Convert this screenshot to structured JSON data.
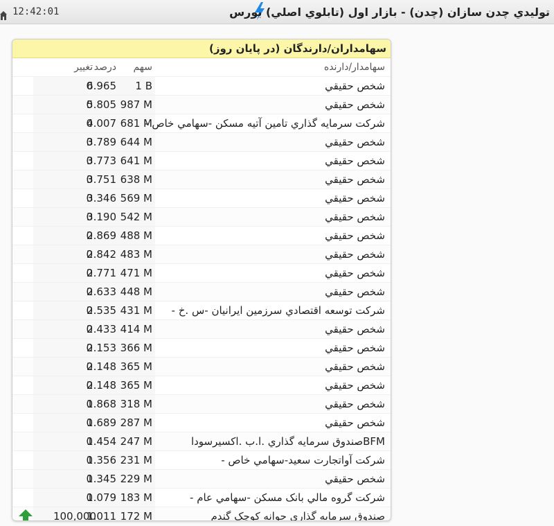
{
  "titlebar": {
    "time": "12:42:01",
    "title": "توليدي چدن سازان (چدن) - بازار اول (تابلوي اصلي) بورس",
    "icons": {
      "left": "home-icon",
      "middle": "lightning-bolt-icon"
    },
    "bolt_color": "#1e88e5"
  },
  "panel": {
    "header": "سهامداران/دارندگان (در پايان روز)",
    "header_bg": "#fbf6a8",
    "columns": {
      "holder": "سهامدار/دارنده",
      "shares": "سهم",
      "percent": "درصد",
      "change": "تغيير"
    },
    "rows": [
      {
        "holder": "شخص حقيقي",
        "shares": "1 B",
        "percent": "6.965",
        "change": "0"
      },
      {
        "holder": "شخص حقيقي",
        "shares": "987 M",
        "percent": "5.805",
        "change": "0"
      },
      {
        "holder": "شرکت سرمايه گذاري تامين آتيه مسکن -سهامي خاص -",
        "shares": "681 M",
        "percent": "4.007",
        "change": "0"
      },
      {
        "holder": "شخص حقيقي",
        "shares": "644 M",
        "percent": "3.789",
        "change": "0"
      },
      {
        "holder": "شخص حقيقي",
        "shares": "641 M",
        "percent": "3.773",
        "change": "0"
      },
      {
        "holder": "شخص حقيقي",
        "shares": "638 M",
        "percent": "3.751",
        "change": "0"
      },
      {
        "holder": "شخص حقيقي",
        "shares": "569 M",
        "percent": "3.346",
        "change": "0"
      },
      {
        "holder": "شخص حقيقي",
        "shares": "542 M",
        "percent": "3.190",
        "change": "0"
      },
      {
        "holder": "شخص حقيقي",
        "shares": "488 M",
        "percent": "2.869",
        "change": "0"
      },
      {
        "holder": "شخص حقيقي",
        "shares": "483 M",
        "percent": "2.842",
        "change": "0"
      },
      {
        "holder": "شخص حقيقي",
        "shares": "471 M",
        "percent": "2.771",
        "change": "0"
      },
      {
        "holder": "شخص حقيقي",
        "shares": "448 M",
        "percent": "2.633",
        "change": "0"
      },
      {
        "holder": "شرکت توسعه اقتصادي سرزمين ايرانيان -س .خ -",
        "shares": "431 M",
        "percent": "2.535",
        "change": "0"
      },
      {
        "holder": "شخص حقيقي",
        "shares": "414 M",
        "percent": "2.433",
        "change": "0"
      },
      {
        "holder": "شخص حقيقي",
        "shares": "366 M",
        "percent": "2.153",
        "change": "0"
      },
      {
        "holder": "شخص حقيقي",
        "shares": "365 M",
        "percent": "2.148",
        "change": "0"
      },
      {
        "holder": "شخص حقيقي",
        "shares": "365 M",
        "percent": "2.148",
        "change": "0"
      },
      {
        "holder": "شخص حقيقي",
        "shares": "318 M",
        "percent": "1.868",
        "change": "0"
      },
      {
        "holder": "شخص حقيقي",
        "shares": "287 M",
        "percent": "1.689",
        "change": "0"
      },
      {
        "holder": "BFMصندوق سرمايه گذاري .ا.ب .اکسيرسودا",
        "shares": "247 M",
        "percent": "1.454",
        "change": "0"
      },
      {
        "holder": "شرکت آواتجارت سعيد-سهامي خاص -",
        "shares": "231 M",
        "percent": "1.356",
        "change": "0"
      },
      {
        "holder": "شخص حقيقي",
        "shares": "229 M",
        "percent": "1.345",
        "change": "0"
      },
      {
        "holder": "شرکت گروه مالي بانک مسکن -سهامي عام -",
        "shares": "183 M",
        "percent": "1.079",
        "change": "0"
      },
      {
        "holder": "صندوق سرمايه گذاري جوانه کوچک گندم",
        "shares": "172 M",
        "percent": "1.011",
        "change": "100,000",
        "trend_icon": "up-arrow-icon",
        "trend_color": "#2e9e3a"
      }
    ]
  }
}
